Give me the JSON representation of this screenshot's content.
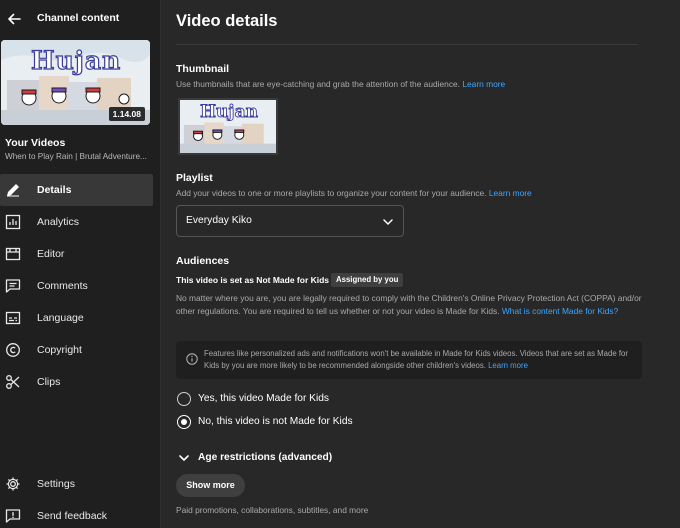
{
  "sidebar": {
    "title": "Channel content",
    "video": {
      "thumbnail_text": "Hujan",
      "duration": "1.14.08",
      "label": "Your Videos",
      "subtitle": "When to Play Rain | Brutal Adventure..."
    },
    "nav": [
      {
        "label": "Details",
        "icon": "pencil-icon",
        "active": true
      },
      {
        "label": "Analytics",
        "icon": "analytics-icon",
        "active": false
      },
      {
        "label": "Editor",
        "icon": "editor-icon",
        "active": false
      },
      {
        "label": "Comments",
        "icon": "comments-icon",
        "active": false
      },
      {
        "label": "Language",
        "icon": "subtitles-icon",
        "active": false
      },
      {
        "label": "Copyright",
        "icon": "copyright-icon",
        "active": false
      },
      {
        "label": "Clips",
        "icon": "scissors-icon",
        "active": false
      }
    ],
    "bottom": [
      {
        "label": "Settings",
        "icon": "gear-icon"
      },
      {
        "label": "Send feedback",
        "icon": "feedback-icon"
      }
    ]
  },
  "main": {
    "title": "Video details",
    "thumbnail": {
      "title": "Thumbnail",
      "desc": "Use thumbnails that are eye-catching and grab the attention of the audience.",
      "link": "Learn more"
    },
    "playlist": {
      "title": "Playlist",
      "desc": "Add your videos to one or more playlists to organize your content for your audience.",
      "link": "Learn more",
      "selected": "Everyday Kiko"
    },
    "audiences": {
      "title": "Audiences",
      "status": "This video is set as Not Made for Kids",
      "badge": "Assigned by you",
      "coppa_text": "No matter where you are, you are legally required to comply with the Children's Online Privacy Protection Act (COPPA) and/or other regulations. You are required to tell us whether or not your video is Made for Kids.",
      "coppa_link": "What is content Made for Kids?",
      "info_text": "Features like personalized ads and notifications won't be available in Made for Kids videos. Videos that are set as Made for Kids by you are more likely to be recommended alongside other children's videos.",
      "info_link": "Learn more",
      "option_yes": "Yes, this video Made for Kids",
      "option_no": "No, this video is not Made for Kids",
      "selected": "no"
    },
    "age_restrictions": "Age restrictions (advanced)",
    "show_more": "Show more",
    "show_more_desc": "Paid promotions, collaborations, subtitles, and more"
  },
  "colors": {
    "background": "#282828",
    "sidebar": "#1f1f1f",
    "link": "#3ea6ff",
    "text_secondary": "#aaaaaa"
  }
}
